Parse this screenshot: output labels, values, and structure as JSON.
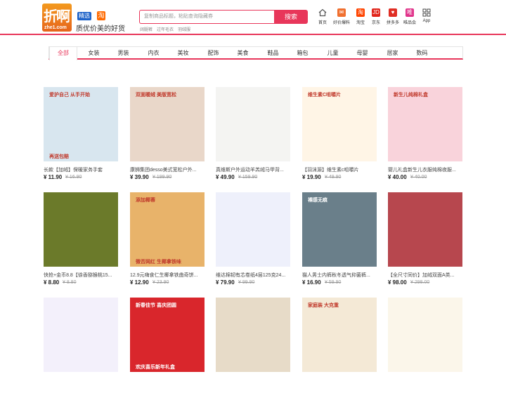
{
  "logo": {
    "big": "折啊",
    "small": "zhe1.com"
  },
  "tags": {
    "jingxuan": "精选",
    "taobao": "淘"
  },
  "slogan": "质优价美的好货",
  "search": {
    "placeholder": "复制商品标题，粘贴查询隐藏券",
    "button": "搜索"
  },
  "hot_words": [
    "阔腿裤",
    "过年毛衣",
    "羽绒服"
  ],
  "nav": [
    {
      "label": "首页",
      "icon": "home-icon",
      "color": "#555555"
    },
    {
      "label": "好价爆料",
      "icon": "mail-icon",
      "color": "#f07030"
    },
    {
      "label": "淘宝",
      "icon": "taobao-icon",
      "color": "#ff4400"
    },
    {
      "label": "京东",
      "icon": "jd-icon",
      "color": "#e1251b"
    },
    {
      "label": "拼多多",
      "icon": "pdd-icon",
      "color": "#e02e24"
    },
    {
      "label": "唯品会",
      "icon": "vip-icon",
      "color": "#e0338a"
    },
    {
      "label": "App",
      "icon": "app-grid-icon",
      "color": "#444444"
    }
  ],
  "categories": [
    "全部",
    "女装",
    "男装",
    "内衣",
    "美妆",
    "配饰",
    "美食",
    "鞋品",
    "箱包",
    "儿童",
    "母婴",
    "居家",
    "数码"
  ],
  "products": [
    {
      "title": "长款【加绒】保暖家务手套",
      "price": "¥ 11.90",
      "orig": "¥ 16.90",
      "bg": "#d8e6ef",
      "img_text": "爱护自己 从手开始",
      "badge": "再送包赔"
    },
    {
      "title": "康狮集团desso美式宽松户外...",
      "price": "¥ 39.90",
      "orig": "¥ 199.90",
      "bg": "#e9d7c9",
      "img_text": "双面暖绒 美版宽松",
      "badge": ""
    },
    {
      "title": "真维斯户外运动羊羔绒马甲背...",
      "price": "¥ 49.90",
      "orig": "¥ 159.90",
      "bg": "#f4f4f2",
      "img_text": "",
      "badge": ""
    },
    {
      "title": "【羽沫源】维生素c咀嚼片",
      "price": "¥ 19.90",
      "orig": "¥ 49.90",
      "bg": "#fff5e6",
      "img_text": "维生素C咀嚼片",
      "badge": ""
    },
    {
      "title": "婴儿礼盒新生儿衣服纯棉夜服...",
      "price": "¥ 40.00",
      "orig": "¥ 40.00",
      "bg": "#f9d3db",
      "img_text": "新生儿纯棉礼盒",
      "badge": ""
    },
    {
      "title": "快抢+金币8.8【徐香猕猴桃15...",
      "price": "¥ 8.80",
      "orig": "¥ 8.80",
      "bg": "#6b7a2a",
      "img_text": "",
      "badge": ""
    },
    {
      "title": "12.9元嗨食仁生椰拿铁曲奇饼...",
      "price": "¥ 12.90",
      "orig": "¥ 23.90",
      "bg": "#e8b36a",
      "img_text": "添加椰蓉",
      "badge": "微否网红 生椰拿铁味"
    },
    {
      "title": "维达棉韧有芯卷纸4层125克24...",
      "price": "¥ 79.90",
      "orig": "¥ 99.90",
      "bg": "#eef0fb",
      "img_text": "",
      "badge": ""
    },
    {
      "title": "猫人男士内裤秋冬透气抑菌裤...",
      "price": "¥ 16.90",
      "orig": "¥ 59.90",
      "bg": "#6a7f8a",
      "img_text": "裸感无痕",
      "badge": ""
    },
    {
      "title": "【全尺寸同价】加绒双面A类...",
      "price": "¥ 98.00",
      "orig": "¥ 298.00",
      "bg": "#b7474e",
      "img_text": "",
      "badge": ""
    },
    {
      "title": "",
      "price": "",
      "orig": "",
      "bg": "#f3f0fb",
      "img_text": "",
      "badge": ""
    },
    {
      "title": "",
      "price": "",
      "orig": "",
      "bg": "#d9262c",
      "img_text": "新春佳节 喜庆团圆",
      "badge": "欢庆喜乐新年礼盒"
    },
    {
      "title": "",
      "price": "",
      "orig": "",
      "bg": "#e7dbc8",
      "img_text": "",
      "badge": ""
    },
    {
      "title": "",
      "price": "",
      "orig": "",
      "bg": "#f4e9d6",
      "img_text": "家庭装 大克重",
      "badge": ""
    },
    {
      "title": "",
      "price": "",
      "orig": "",
      "bg": "#fbf6ea",
      "img_text": "",
      "badge": ""
    }
  ]
}
